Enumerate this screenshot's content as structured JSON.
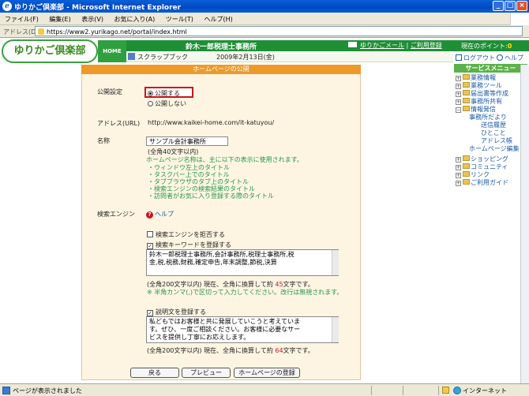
{
  "window": {
    "title": "ゆりかご倶楽部 - Microsoft Internet Explorer",
    "minimize_glyph": "_",
    "maximize_glyph": "□",
    "close_glyph": "×"
  },
  "menu": [
    "ファイル(F)",
    "編集(E)",
    "表示(V)",
    "お気に入り(A)",
    "ツール(T)",
    "ヘルプ(H)"
  ],
  "address": {
    "label": "アドレス(D)",
    "url": "https://www2.yurikago.net/portal/index.html"
  },
  "site": {
    "logo": "ゆりかご倶楽部",
    "home_label": "HOME",
    "firm_name": "鈴木一郎税理士事務所",
    "mail_link": "ゆりかごメール",
    "separator": "|",
    "guide_link": "ご利用登録",
    "points_label": "現在のポイント:",
    "points_value": "0",
    "scrapbook": "スクラップブック",
    "date": "2009年2月13日(金)"
  },
  "sidebar": {
    "logout": "ログアウト",
    "help": "ヘルプ",
    "header": "サービスメニュー",
    "items": [
      {
        "label": "業務情報",
        "pm": "+"
      },
      {
        "label": "業務ツール",
        "pm": "+"
      },
      {
        "label": "届出書等作成",
        "pm": "+"
      },
      {
        "label": "事務所共有",
        "pm": "+"
      },
      {
        "label": "情報発信",
        "pm": "−"
      }
    ],
    "sub_items": [
      "事務所だより",
      "送信履歴",
      "ひとこと",
      "アドレス帳",
      "ホームページ編集"
    ],
    "items2": [
      {
        "label": "ショッピング",
        "pm": "+"
      },
      {
        "label": "コミュニティ",
        "pm": "+"
      },
      {
        "label": "リンク",
        "pm": "+"
      },
      {
        "label": "ご利用ガイド",
        "pm": "+"
      }
    ]
  },
  "form": {
    "panel_title": "ホームページの公開",
    "publish_label": "公開設定",
    "publish_on": "公開する",
    "publish_off": "公開しない",
    "url_label": "アドレス(URL)",
    "url_value": "http://www.kaikei-home.com/it-katuyou/",
    "name_label": "名称",
    "name_value": "サンプル会計事務所",
    "name_limit": "(全角40文字以内)",
    "name_note_title": "ホームページ名称は、主に以下の表示に使用されます。",
    "name_notes": [
      "・ウィンドウ左上のタイトル",
      "・タスクバー上でのタイトル",
      "・タブブラウザのタブ上のタイトル",
      "・検索エンジンの検索結果のタイトル",
      "・訪問者がお気に入り登録する際のタイトル"
    ],
    "search_label": "検索エンジン",
    "search_help": "ヘルプ",
    "refuse_search": "検索エンジンを拒否する",
    "register_keywords": "検索キーワードを登録する",
    "keywords_value": "鈴木一郎税理士事務所,会計事務所,税理士事務所,税\n金,税,税務,財務,確定申告,年末調整,節税,決算",
    "keywords_count_prefix": "(全角200文字以内) 現在、全角に換算して約 ",
    "keywords_count": "45",
    "keywords_count_suffix": "文字です。",
    "keywords_note": "※ 半角カンマ(,)で区切って入力してください。改行は無視されます。",
    "register_description": "説明文を登録する",
    "description_value": "私どもではお客様と共に発展していこうと考えていま\nす。ぜひ、一度ご相談ください。お客様に必要なサー\nビスを提供し丁寧にお応えします。",
    "desc_count_prefix": "(全角200文字以内) 現在、全角に換算して約 ",
    "desc_count": "64",
    "desc_count_suffix": "文字です。",
    "back_button": "戻る",
    "preview_button": "プレビュー",
    "register_button": "ホームページの登録"
  },
  "status": {
    "text": "ページが表示されました",
    "zone": "インターネット"
  }
}
